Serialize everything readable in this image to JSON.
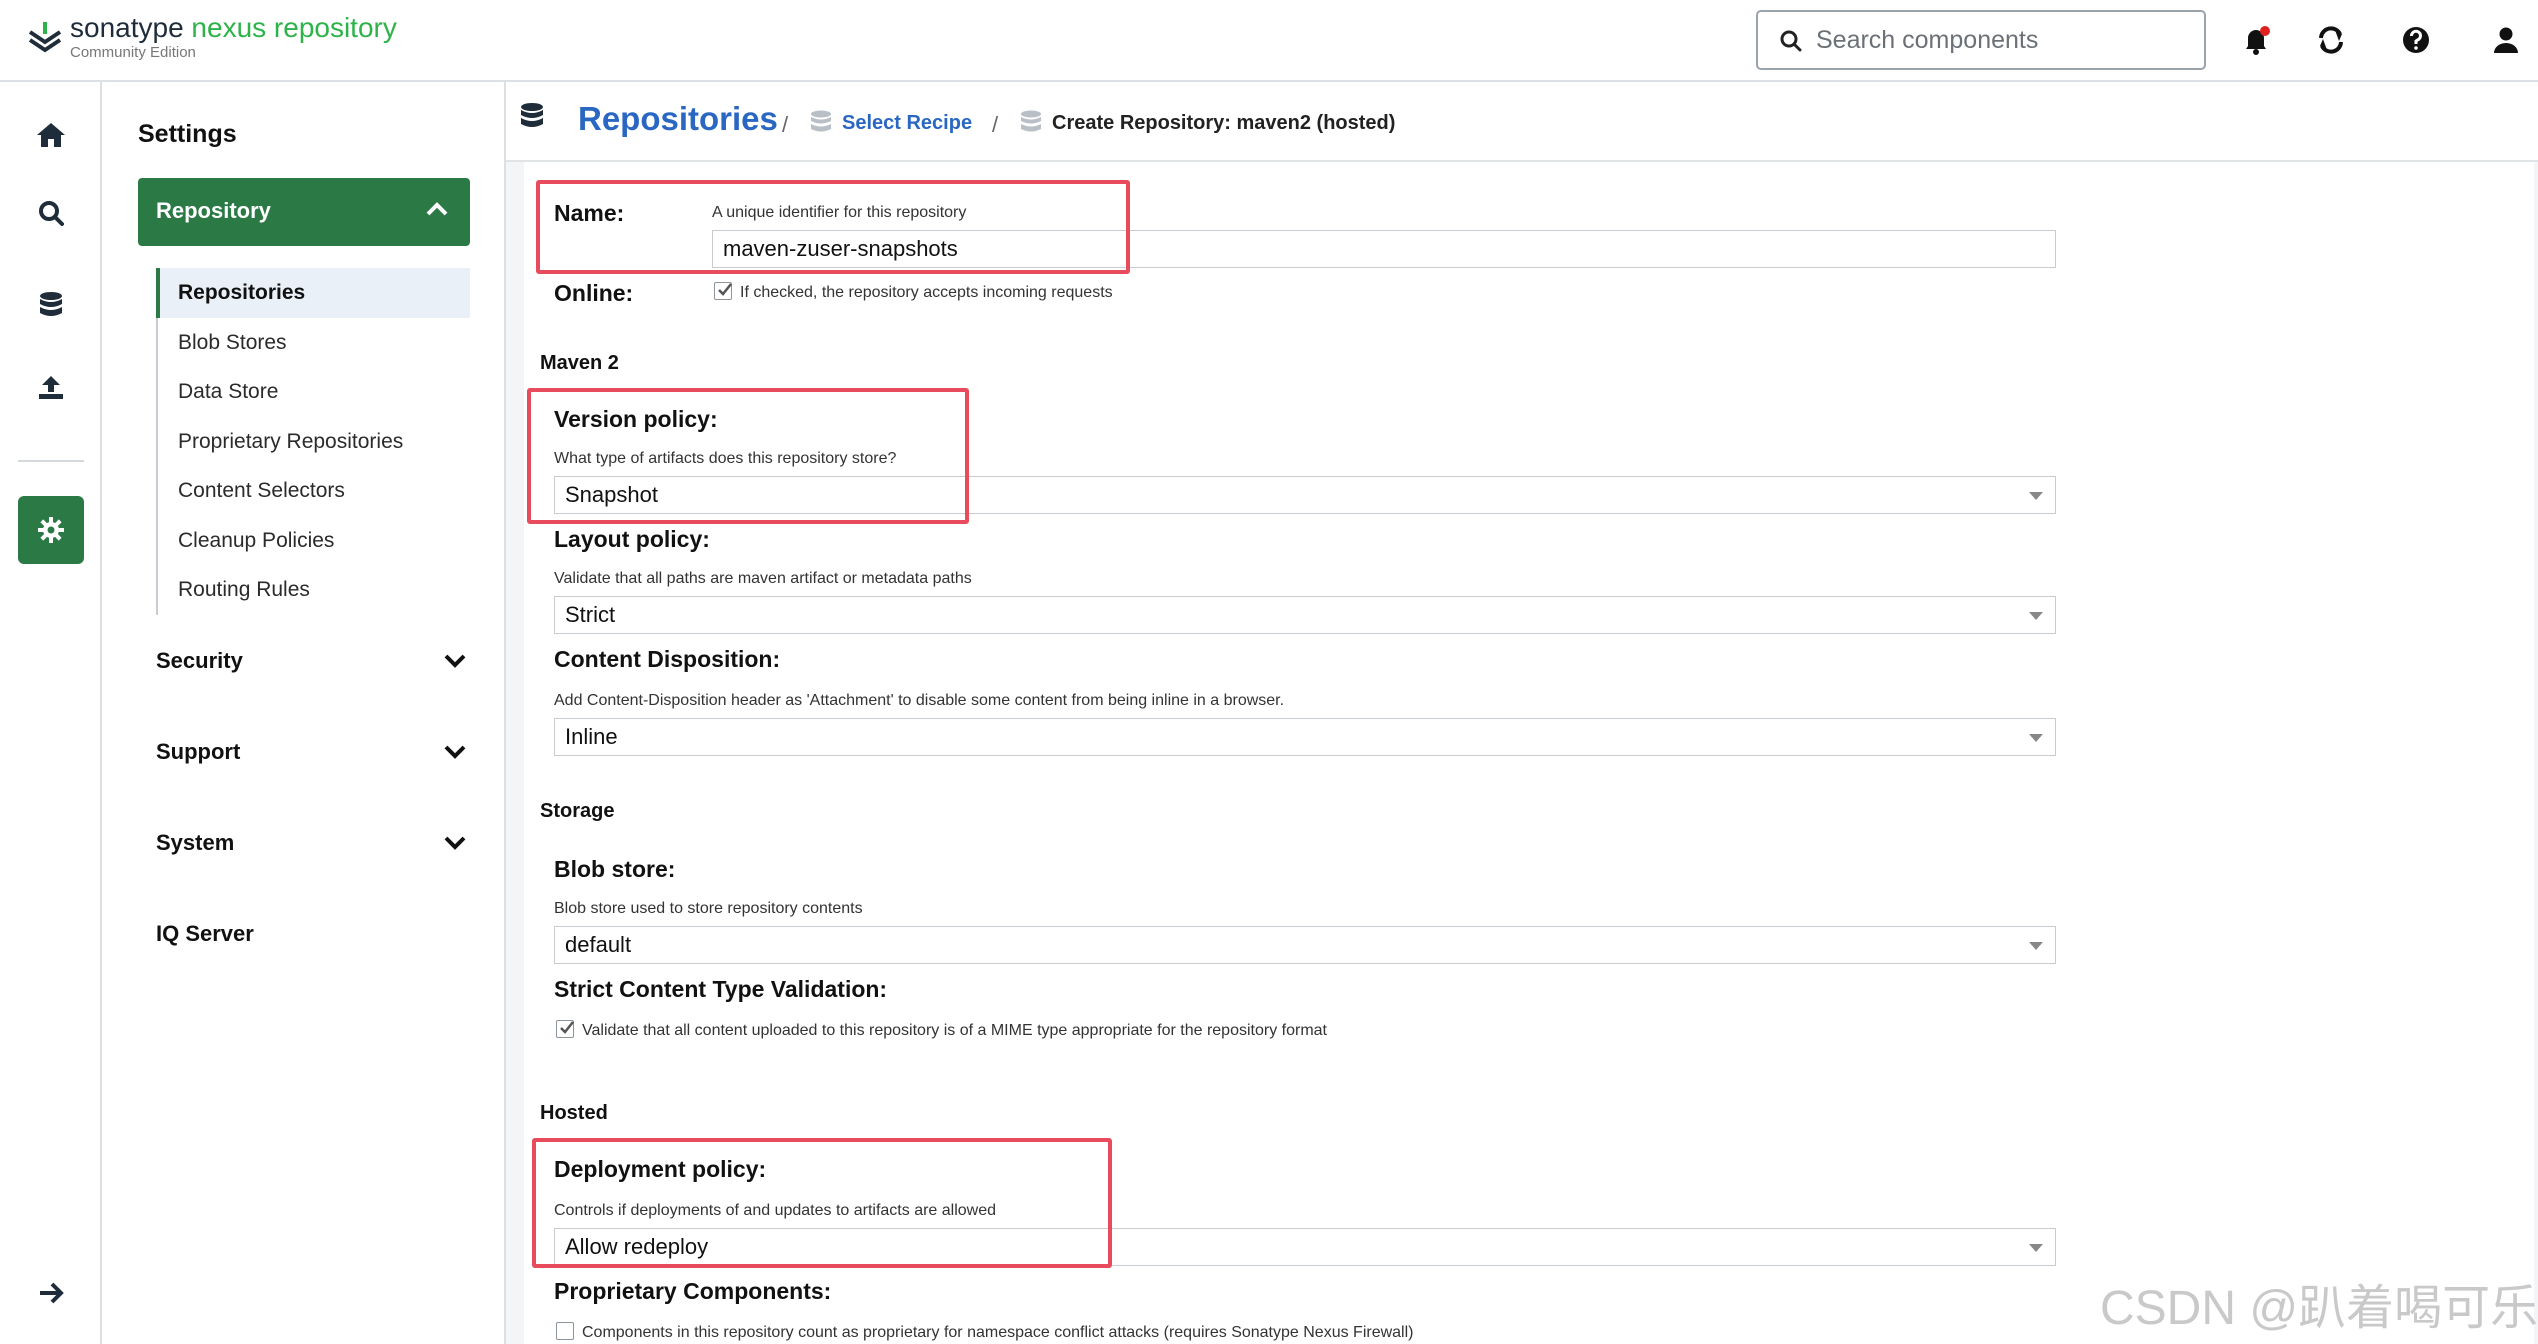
{
  "header": {
    "brand_primary": "sonatype",
    "brand_accent": "nexus repository",
    "edition": "Community Edition",
    "search_placeholder": "Search components",
    "icons": [
      "bell-icon",
      "refresh-icon",
      "help-icon",
      "user-icon"
    ]
  },
  "rail": {
    "items": [
      "home-icon",
      "search-icon",
      "database-icon",
      "upload-icon",
      "gear-icon",
      "arrow-right-icon"
    ]
  },
  "sidebar": {
    "title": "Settings",
    "active_group": "Repository",
    "items": [
      {
        "label": "Repositories",
        "active": true
      },
      {
        "label": "Blob Stores"
      },
      {
        "label": "Data Store"
      },
      {
        "label": "Proprietary Repositories"
      },
      {
        "label": "Content Selectors"
      },
      {
        "label": "Cleanup Policies"
      },
      {
        "label": "Routing Rules"
      }
    ],
    "groups": [
      "Security",
      "Support",
      "System",
      "IQ Server"
    ]
  },
  "breadcrumb": {
    "title": "Repositories",
    "sep": "/",
    "recipe": "Select Recipe",
    "current": "Create Repository: maven2 (hosted)"
  },
  "form": {
    "name_label": "Name:",
    "name_help": "A unique identifier for this repository",
    "name_value": "maven-zuser-snapshots",
    "online_label": "Online:",
    "online_help": "If checked, the repository accepts incoming requests",
    "maven_section": "Maven 2",
    "version_label": "Version policy:",
    "version_help": "What type of artifacts does this repository store?",
    "version_value": "Snapshot",
    "layout_label": "Layout policy:",
    "layout_help": "Validate that all paths are maven artifact or metadata paths",
    "layout_value": "Strict",
    "disposition_label": "Content Disposition:",
    "disposition_help": "Add Content-Disposition header as 'Attachment' to disable some content from being inline in a browser.",
    "disposition_value": "Inline",
    "storage_section": "Storage",
    "blob_label": "Blob store:",
    "blob_help": "Blob store used to store repository contents",
    "blob_value": "default",
    "strict_label": "Strict Content Type Validation:",
    "strict_help": "Validate that all content uploaded to this repository is of a MIME type appropriate for the repository format",
    "hosted_section": "Hosted",
    "deploy_label": "Deployment policy:",
    "deploy_help": "Controls if deployments of and updates to artifacts are allowed",
    "deploy_value": "Allow redeploy",
    "proprietary_label": "Proprietary Components:",
    "proprietary_help": "Components in this repository count as proprietary for namespace conflict attacks (requires Sonatype Nexus Firewall)"
  },
  "watermark": "CSDN @趴着喝可乐",
  "colors": {
    "brand_green": "#2b7a46",
    "accent_green": "#2db34a",
    "link_blue": "#2a67c2",
    "highlight_red": "#e84b5b"
  }
}
